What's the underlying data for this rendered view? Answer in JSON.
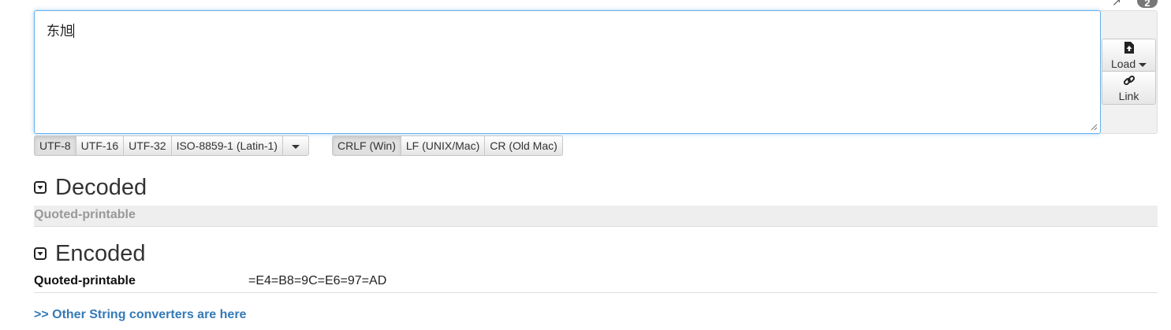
{
  "top": {
    "badge_count": "2"
  },
  "input": {
    "text": "东旭"
  },
  "side": {
    "load_label": "Load",
    "link_label": "Link"
  },
  "encodings": {
    "items": [
      "UTF-8",
      "UTF-16",
      "UTF-32",
      "ISO-8859-1 (Latin-1)"
    ],
    "selected": "UTF-8"
  },
  "newlines": {
    "items": [
      "CRLF (Win)",
      "LF (UNIX/Mac)",
      "CR (Old Mac)"
    ],
    "selected": "CRLF (Win)"
  },
  "decoded": {
    "title": "Decoded",
    "row": {
      "key": "Quoted-printable",
      "value": ""
    }
  },
  "encoded": {
    "title": "Encoded",
    "row": {
      "key": "Quoted-printable",
      "value": "=E4=B8=9C=E6=97=AD"
    }
  },
  "footer": {
    "link_text": ">> Other String converters are here"
  },
  "colors": {
    "accent": "#337ab7",
    "focus_border": "#66afe9",
    "muted_row": "#eeeeee"
  }
}
